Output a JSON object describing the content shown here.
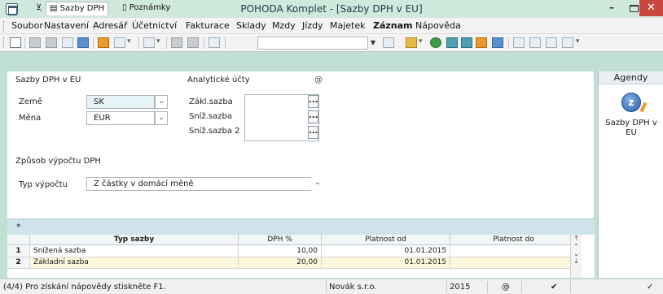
{
  "window": {
    "title": "POHODA Komplet - [Sazby DPH v EU]",
    "dot": ".",
    "minimize": "–",
    "close": "✕"
  },
  "menu": [
    "Soubor",
    "Nastavení",
    "Adresář",
    "Účetnictví",
    "Fakturace",
    "Sklady",
    "Mzdy",
    "Jízdy",
    "Majetek",
    "Záznam",
    "Nápověda"
  ],
  "toolbar": {
    "search_value": ""
  },
  "form": {
    "section_title": "Sazby DPH v EU",
    "analytic_title": "Analytické účty",
    "country_label": "Země",
    "country_value": "SK",
    "currency_label": "Měna",
    "currency_value": "EUR",
    "base_rate_label": "Zákl.sazba",
    "reduced_rate_label": "Sníž.sazba",
    "reduced_rate2_label": "Sníž.sazba 2",
    "calc_section": "Způsob výpočtu DPH",
    "calc_type_label": "Typ výpočtu",
    "calc_type_value": "Z částky v domácí měně",
    "dots": "..."
  },
  "tabs": {
    "star": "*",
    "vat_rates": "Sazby DPH",
    "notes": "Poznámky"
  },
  "grid": {
    "headers": [
      "Typ sazby",
      "DPH %",
      "Platnost od",
      "Platnost do"
    ],
    "rows": [
      {
        "n": "1",
        "type": "Snížená sazba",
        "vat": "10,00",
        "from": "01.01.2015",
        "to": ""
      },
      {
        "n": "2",
        "type": "Základní sazba",
        "vat": "20,00",
        "from": "01.01.2015",
        "to": ""
      }
    ]
  },
  "agendy": {
    "title": "Agendy",
    "item_label": "Sazby DPH v EU"
  },
  "status": {
    "help": "(4/4) Pro získání nápovědy stiskněte F1.",
    "company": "Novák s.r.o.",
    "year": "2015"
  }
}
